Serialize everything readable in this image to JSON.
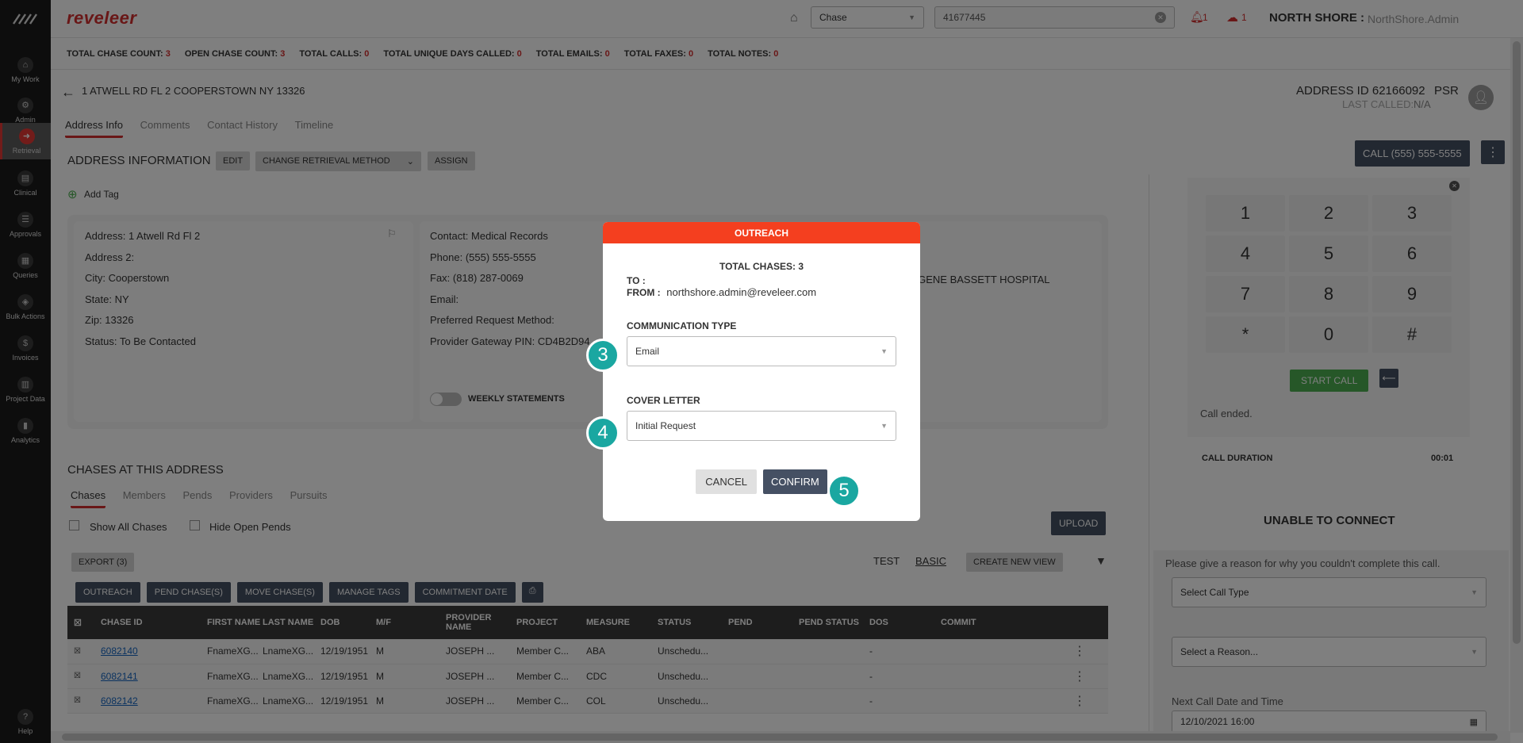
{
  "sidebar": {
    "items": [
      {
        "label": "My Work"
      },
      {
        "label": "Admin"
      },
      {
        "label": "Retrieval"
      },
      {
        "label": "Clinical"
      },
      {
        "label": "Approvals"
      },
      {
        "label": "Queries"
      },
      {
        "label": "Bulk Actions"
      },
      {
        "label": "Invoices"
      },
      {
        "label": "Project Data"
      },
      {
        "label": "Analytics"
      }
    ],
    "help_label": "Help"
  },
  "topbar": {
    "brand": "reveleer",
    "search_type": "Chase",
    "search_value": "41677445",
    "alerts_count": "1",
    "cloud_count": "1",
    "org_name": "NORTH SHORE :",
    "user": "NorthShore.Admin"
  },
  "stats": [
    {
      "label": "TOTAL CHASE COUNT:",
      "value": "3"
    },
    {
      "label": "OPEN CHASE COUNT:",
      "value": "3"
    },
    {
      "label": "TOTAL CALLS:",
      "value": "0"
    },
    {
      "label": "TOTAL UNIQUE DAYS CALLED:",
      "value": "0"
    },
    {
      "label": "TOTAL EMAILS:",
      "value": "0"
    },
    {
      "label": "TOTAL FAXES:",
      "value": "0"
    },
    {
      "label": "TOTAL NOTES:",
      "value": "0"
    }
  ],
  "header": {
    "address": "1 ATWELL RD FL 2 COOPERSTOWN NY 13326",
    "address_id": "ADDRESS ID 62166092",
    "role": "PSR",
    "last_called_label": "LAST CALLED:",
    "last_called_value": "N/A"
  },
  "tabs": [
    "Address Info",
    "Comments",
    "Contact History",
    "Timeline"
  ],
  "address_section": {
    "title": "ADDRESS INFORMATION",
    "edit": "EDIT",
    "change_method": "CHANGE RETRIEVAL METHOD",
    "assign": "ASSIGN",
    "add_tag": "Add Tag",
    "left": [
      {
        "label": "Address:",
        "value": "1 Atwell Rd Fl 2"
      },
      {
        "label": "Address 2:",
        "value": ""
      },
      {
        "label": "City:",
        "value": "Cooperstown"
      },
      {
        "label": "State:",
        "value": "NY"
      },
      {
        "label": "Zip:",
        "value": "13326"
      },
      {
        "label": "Status:",
        "value": "To Be Contacted"
      }
    ],
    "right": [
      {
        "label": "Contact:",
        "value": "Medical Records"
      },
      {
        "label": "Phone:",
        "value": "(555) 555-5555"
      },
      {
        "label": "Fax:",
        "value": "(818) 287-0069"
      },
      {
        "label": "Email:",
        "value": ""
      },
      {
        "label": "Preferred Request Method:",
        "value": ""
      },
      {
        "label": "Provider Gateway PIN:",
        "value": "CD4B2D94"
      }
    ],
    "weekly_statements": "WEEKLY STATEMENTS",
    "hospital_fragment": "OGENE BASSETT HOSPITAL"
  },
  "chases": {
    "title": "CHASES AT THIS ADDRESS",
    "tabs": [
      "Chases",
      "Members",
      "Pends",
      "Providers",
      "Pursuits"
    ],
    "show_all": "Show All Chases",
    "hide_open": "Hide Open Pends",
    "upload": "UPLOAD",
    "export": "EXPORT (3)",
    "view_test": "TEST",
    "view_basic": "BASIC",
    "create_view": "CREATE NEW VIEW",
    "actions": [
      "OUTREACH",
      "PEND CHASE(S)",
      "MOVE CHASE(S)",
      "MANAGE TAGS",
      "COMMITMENT DATE"
    ],
    "columns": [
      "CHASE ID",
      "FIRST NAME",
      "LAST NAME",
      "DOB",
      "M/F",
      "PROVIDER NAME",
      "PROJECT",
      "MEASURE",
      "STATUS",
      "PEND",
      "PEND STATUS",
      "DOS",
      "COMMIT"
    ],
    "rows": [
      [
        "6082140",
        "FnameXG...",
        "LnameXG...",
        "12/19/1951",
        "M",
        "JOSEPH ...",
        "Member C...",
        "ABA",
        "Unschedu...",
        "",
        "",
        "-",
        ""
      ],
      [
        "6082141",
        "FnameXG...",
        "LnameXG...",
        "12/19/1951",
        "M",
        "JOSEPH ...",
        "Member C...",
        "CDC",
        "Unschedu...",
        "",
        "",
        "-",
        ""
      ],
      [
        "6082142",
        "FnameXG...",
        "LnameXG...",
        "12/19/1951",
        "M",
        "JOSEPH ...",
        "Member C...",
        "COL",
        "Unschedu...",
        "",
        "",
        "-",
        ""
      ]
    ]
  },
  "dialer": {
    "call_button": "CALL (555) 555-5555",
    "keys": [
      "1",
      "2",
      "3",
      "4",
      "5",
      "6",
      "7",
      "8",
      "9",
      "*",
      "0",
      "#"
    ],
    "start_call": "START CALL",
    "status": "Call ended.",
    "duration_label": "CALL DURATION",
    "duration_value": "00:01",
    "unable_title": "UNABLE TO CONNECT",
    "reason_prompt": "Please give a reason for why you couldn't complete this call.",
    "select_call_type": "Select Call Type",
    "select_reason": "Select a Reason...",
    "next_call_label": "Next Call Date and Time",
    "next_call_value": "12/10/2021 16:00"
  },
  "modal": {
    "title": "OUTREACH",
    "total_chases": "TOTAL CHASES: 3",
    "to_label": "TO :",
    "from_label": "FROM :",
    "from_value": "northshore.admin@reveleer.com",
    "comm_type_label": "COMMUNICATION TYPE",
    "comm_type_value": "Email",
    "cover_letter_label": "COVER LETTER",
    "cover_letter_value": "Initial Request",
    "cancel": "CANCEL",
    "confirm": "CONFIRM",
    "markers": [
      "3",
      "4",
      "5"
    ]
  }
}
